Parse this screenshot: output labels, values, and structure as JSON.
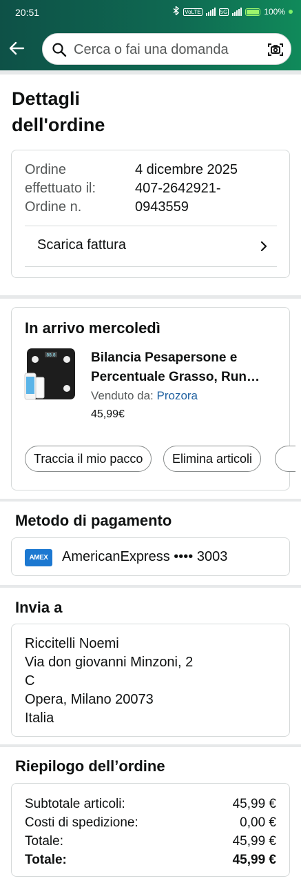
{
  "status_bar": {
    "time": "20:51",
    "battery_text": "100%",
    "net_tag_1": "VoLTE",
    "net_tag_2": "5G"
  },
  "header": {
    "search_placeholder": "Cerca o fai una domanda"
  },
  "page_title_line1": "Dettagli",
  "page_title_line2": "dell'ordine",
  "order_info": {
    "placed_label_line1": "Ordine",
    "placed_label_line2": "effettuato il:",
    "placed_value": "4 dicembre 2025",
    "number_label": "Ordine n.",
    "number_value_line1": "407-2642921-",
    "number_value_line2": "0943559",
    "invoice_link": "Scarica fattura"
  },
  "shipment": {
    "title": "In arrivo mercoledì",
    "product_name_line1": "Bilancia Pesapersone e",
    "product_name_line2": "Percentuale Grasso, Run…",
    "sold_by_label": "Venduto da: ",
    "seller": "Prozora",
    "price": "45,99€",
    "track_button": "Traccia il mio pacco",
    "delete_button": "Elimina articoli"
  },
  "payment": {
    "title": "Metodo di pagamento",
    "card_logo_text": "AMEX",
    "card_text": "AmericanExpress •••• 3003"
  },
  "shipping_address": {
    "title": "Invia a",
    "lines": [
      "Riccitelli Noemi",
      "Via don giovanni Minzoni, 2",
      "C",
      "Opera, Milano 20073",
      "Italia"
    ]
  },
  "summary": {
    "title": "Riepilogo dell’ordine",
    "rows": [
      {
        "label": "Subtotale articoli:",
        "value": "45,99 €"
      },
      {
        "label": "Costi di spedizione:",
        "value": "0,00 €"
      },
      {
        "label": "Totale:",
        "value": "45,99 €"
      },
      {
        "label": "Totale:",
        "value": "45,99 €"
      }
    ]
  },
  "colors": {
    "header_green": "#0f6a52",
    "link_blue": "#2162a1",
    "amex_blue": "#1c78d1"
  }
}
